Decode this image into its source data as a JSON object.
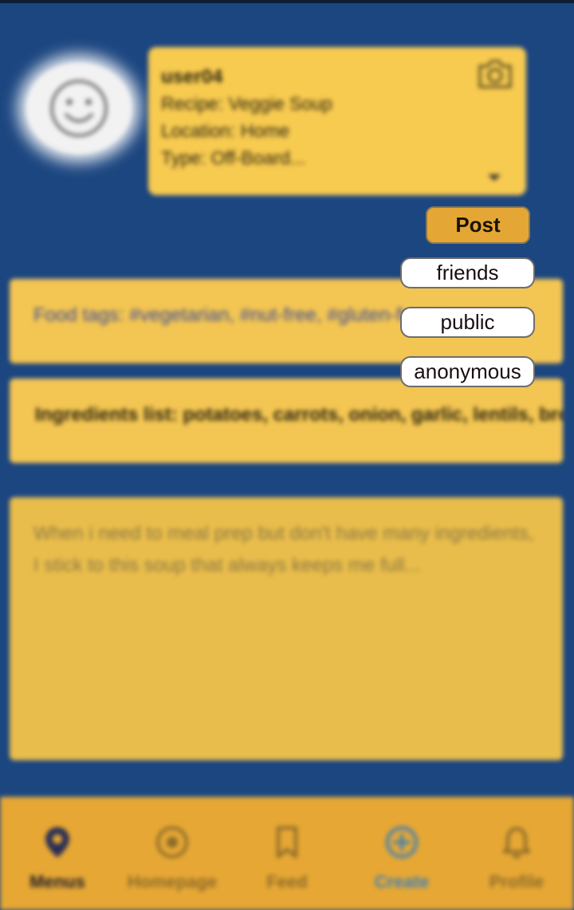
{
  "card": {
    "username": "user04",
    "recipe": "Recipe: Veggie Soup",
    "location": "Location: Home",
    "type": "Type: Off-Board..."
  },
  "tags_text": "Food tags: #vegetarian, #nut-free, #gluten-free, vegan",
  "ingredients_text": "Ingredients list: potatoes, carrots, onion, garlic, lentils, broccoli, tomato paste, broth of choice,...",
  "story_text": "When i need to meal prep but don't have many ingredients, I stick to this soup that always keeps me full...",
  "post_button": "Post",
  "visibility_options": [
    "friends",
    "public",
    "anonymous"
  ],
  "nav": [
    {
      "label": "Menus",
      "icon": "location-pin-icon",
      "active": true
    },
    {
      "label": "Homepage",
      "icon": "home-circle-icon"
    },
    {
      "label": "Feed",
      "icon": "bookmark-icon"
    },
    {
      "label": "Create",
      "icon": "plus-circle-icon"
    },
    {
      "label": "Profile",
      "icon": "bell-icon"
    }
  ],
  "colors": {
    "background": "#1c4680",
    "card": "#f7ca50",
    "nav_bar": "#e6a734",
    "create_accent": "#3f7fb6"
  }
}
